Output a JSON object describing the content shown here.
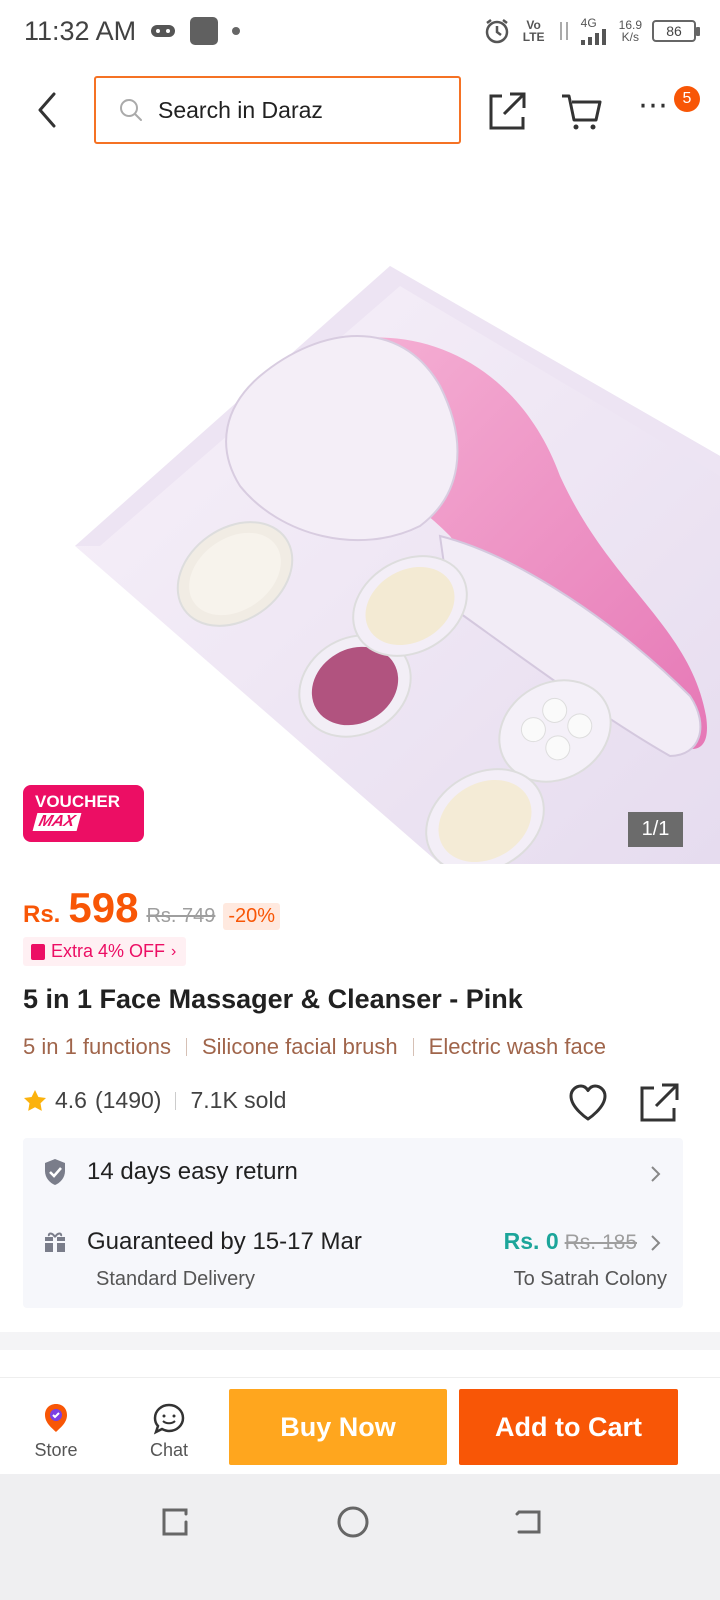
{
  "status_bar": {
    "time": "11:32 AM",
    "volte": "Vo LTE",
    "network": "4G",
    "speed_value": "16.9",
    "speed_unit": "K/s",
    "battery": "86"
  },
  "header": {
    "search_placeholder": "Search in Daraz",
    "cart_count": "5"
  },
  "gallery": {
    "voucher_line1": "VOUCHER",
    "voucher_line2": "MAX",
    "counter": "1/1"
  },
  "product": {
    "currency": "Rs.",
    "price": "598",
    "original_price": "Rs. 749",
    "discount": "-20%",
    "extra_off": "Extra 4% OFF",
    "title": "5 in 1 Face Massager & Cleanser - Pink",
    "highlights": [
      "5 in 1 functions",
      "Silicone facial brush",
      "Electric wash face"
    ],
    "rating": "4.6",
    "review_count": "(1490)",
    "sold": "7.1K sold"
  },
  "service": {
    "return_text": "14 days easy return",
    "delivery_text": "Guaranteed by 15-17 Mar",
    "delivery_type": "Standard Delivery",
    "fee": "Rs. 0",
    "fee_original": "Rs. 185",
    "location": "To Satrah Colony"
  },
  "bottom_bar": {
    "store_label": "Store",
    "chat_label": "Chat",
    "buy_now": "Buy Now",
    "add_to_cart": "Add to Cart"
  },
  "colors": {
    "accent": "#f85606",
    "buy_now": "#ffa61e",
    "voucher": "#ec0e64",
    "free_shipping": "#1ca59a"
  }
}
